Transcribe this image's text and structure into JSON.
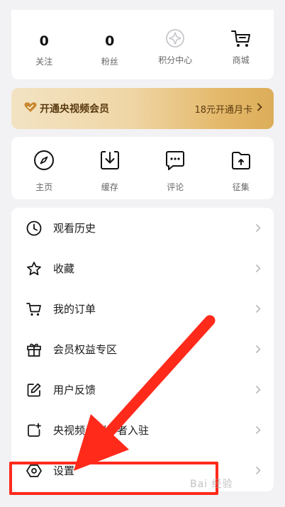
{
  "stats": [
    {
      "value": "0",
      "label": "关注"
    },
    {
      "value": "0",
      "label": "粉丝"
    },
    {
      "icon": "points-compass-icon",
      "label": "积分中心"
    },
    {
      "icon": "cart-icon",
      "label": "商城"
    }
  ],
  "vip": {
    "title": "开通央视频会员",
    "offer": "18元开通月卡",
    "colors": {
      "gradient_start": "#f3e3c3",
      "gradient_end": "#dcae5a",
      "text": "#5a3a10"
    }
  },
  "quick_actions": [
    {
      "icon": "compass-icon",
      "label": "主页"
    },
    {
      "icon": "download-icon",
      "label": "缓存"
    },
    {
      "icon": "comment-icon",
      "label": "评论"
    },
    {
      "icon": "folder-upload-icon",
      "label": "征集"
    }
  ],
  "menu": [
    {
      "icon": "clock-icon",
      "label": "观看历史"
    },
    {
      "icon": "star-icon",
      "label": "收藏"
    },
    {
      "icon": "cart-icon",
      "label": "我的订单"
    },
    {
      "icon": "gift-icon",
      "label": "会员权益专区"
    },
    {
      "icon": "edit-icon",
      "label": "用户反馈"
    },
    {
      "icon": "add-video-icon",
      "label": "央视频号创作者入驻"
    },
    {
      "icon": "settings-hexagon-icon",
      "label": "设置"
    }
  ],
  "annotation": {
    "color": "#ff2a1a",
    "watermark": "Bai 经验"
  }
}
